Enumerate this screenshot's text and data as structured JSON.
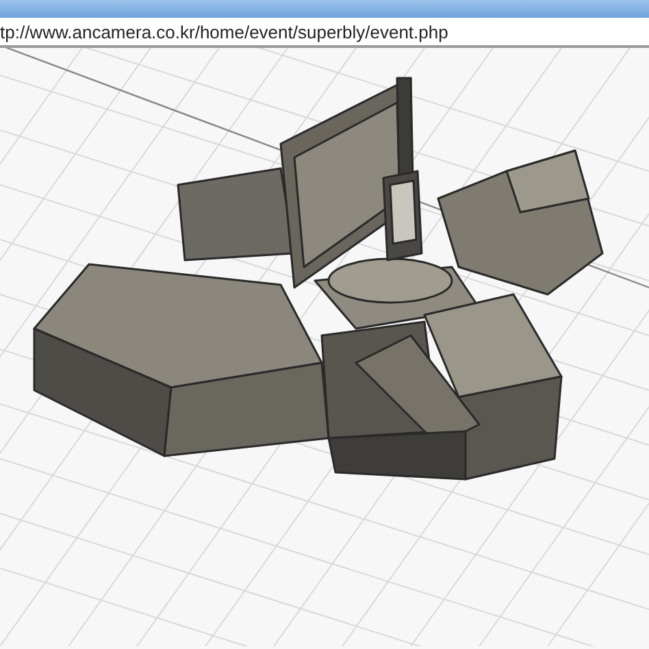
{
  "browser": {
    "url": "tp://www.ancamera.co.kr/home/event/superbly/event.php"
  }
}
